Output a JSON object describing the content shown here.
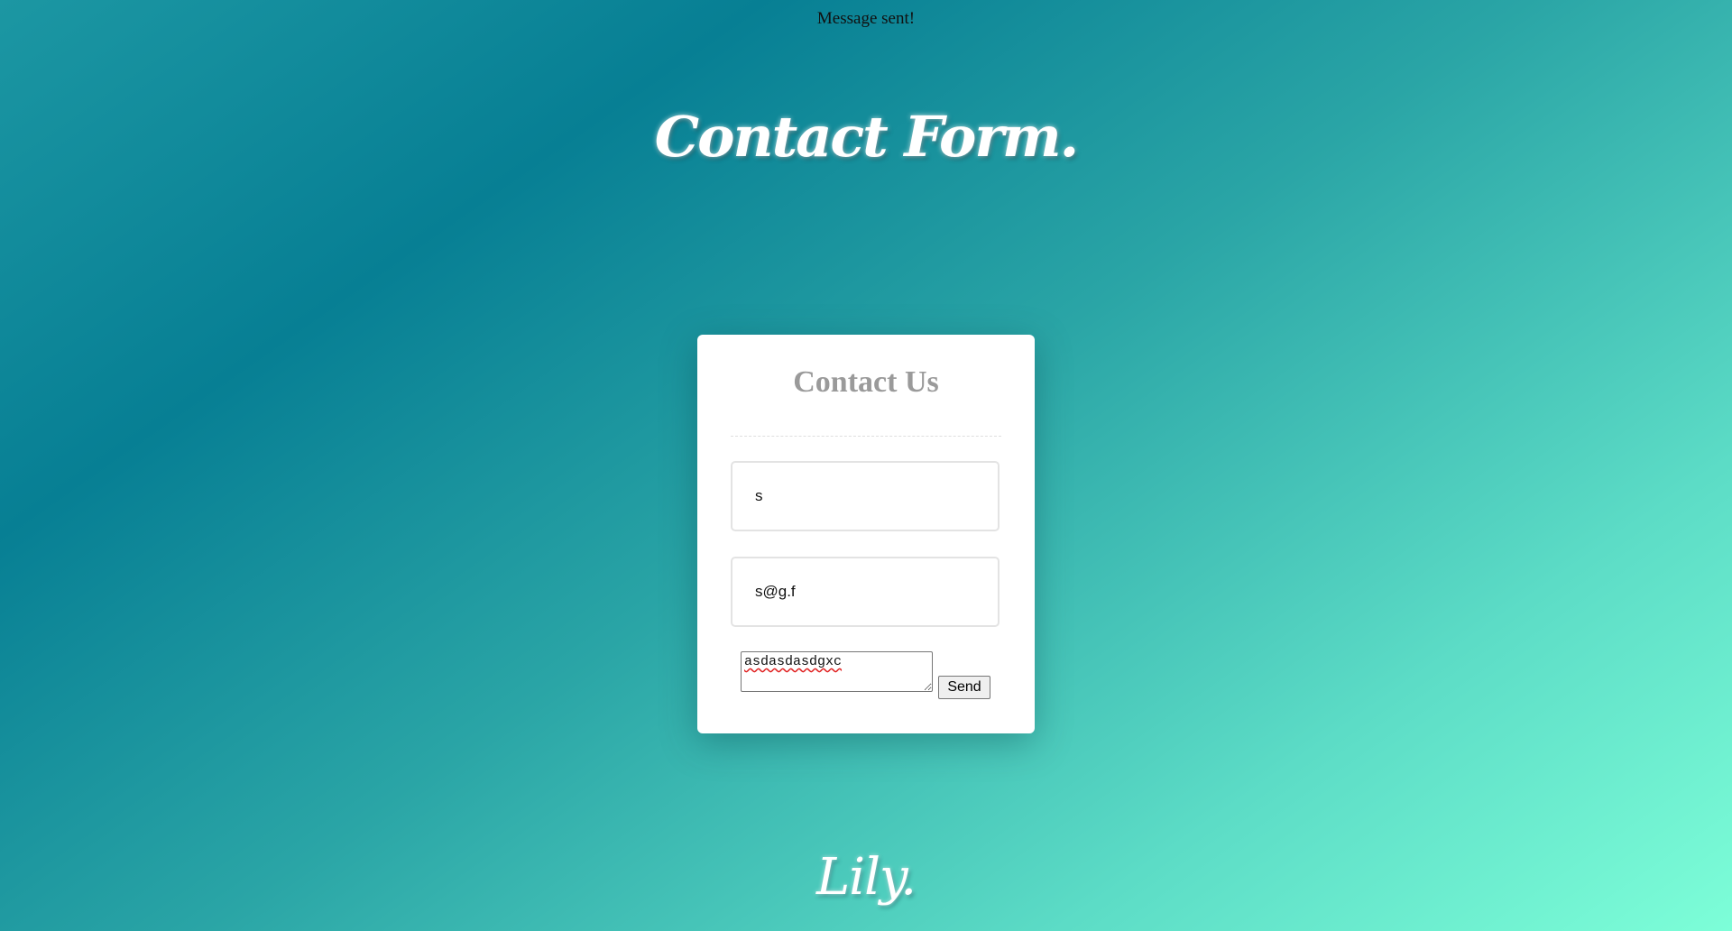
{
  "status_message": "Message sent!",
  "hero_title": "Contact Form.",
  "form": {
    "title": "Contact Us",
    "name_value": "s",
    "email_value": "s@g.f",
    "message_value": "asdasdasdgxc",
    "send_label": "Send"
  },
  "signature": "Lily.",
  "colors": {
    "gradient_dark": "#077f94",
    "gradient_light": "#7dfed8",
    "card_background": "#ffffff",
    "card_title": "#9a9a9a"
  }
}
